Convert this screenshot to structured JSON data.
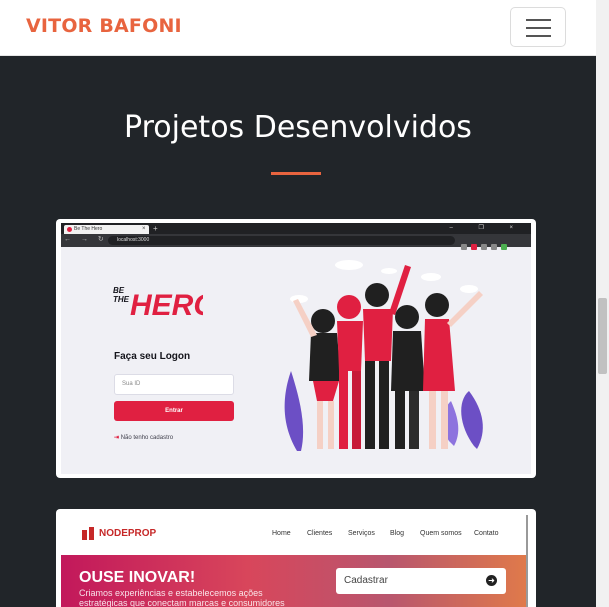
{
  "navbar": {
    "brand": "VITOR BAFONI",
    "menu_icon": "hamburger-icon"
  },
  "section": {
    "title": "Projetos Desenvolvidos",
    "accent_color": "#e8643f"
  },
  "projects": [
    {
      "name": "Be The Hero",
      "browser": {
        "tab_title": "Be The Hero",
        "url": "localhost:3000"
      },
      "logo": "BE THE HERO",
      "login_title": "Faça seu Logon",
      "input_placeholder": "Sua ID",
      "button_label": "Entrar",
      "link_label": "Não tenho cadastro",
      "brand_color": "#e02041"
    },
    {
      "name": "NodeProp",
      "logo": "NODEPROP",
      "menu": [
        "Home",
        "Clientes",
        "Serviços",
        "Blog",
        "Quem somos",
        "Contato"
      ],
      "banner_title": "OUSE INOVAR!",
      "banner_text": "Criamos experiências e estabelecemos ações estratégicas que conectam marcas e consumidores",
      "form_label": "Cadastrar"
    }
  ]
}
